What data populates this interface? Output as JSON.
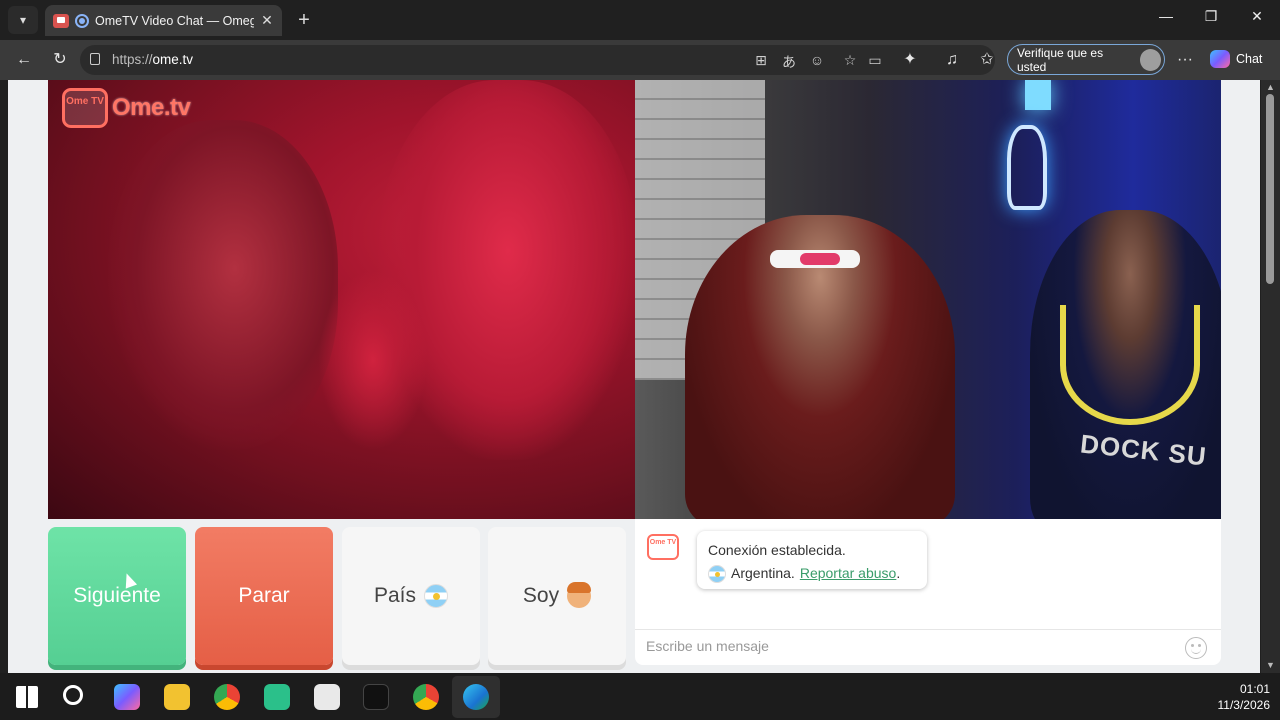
{
  "browser": {
    "tab_title": "OmeTV Video Chat — Omegle",
    "tab_close": "✕",
    "new_tab": "+",
    "url_prefix": "https://",
    "url_host": "ome.tv",
    "profile_label": "Verifique que es usted",
    "chat_label": "Chat",
    "more": "···"
  },
  "window_controls": {
    "minimize": "—",
    "restore": "❐",
    "close": "✕"
  },
  "logo": {
    "tv_text": "Ome TV",
    "brand": "Ome.tv"
  },
  "right_video": {
    "shirt_text": "DOCK SU"
  },
  "controls": {
    "next_label": "Siguiente",
    "stop_label": "Parar",
    "country_label": "País",
    "me_label": "Soy"
  },
  "chat": {
    "logo_text": "Ome TV",
    "status": "Conexión establecida.",
    "country": "Argentina.",
    "report_link": "Reportar abuso",
    "period": ".",
    "placeholder": "Escribe un mensaje"
  },
  "taskbar": {
    "time": "01:01",
    "date": "11/3/2026"
  },
  "colors": {
    "next": "#55cf93",
    "stop": "#e55f46",
    "link": "#3a9c6a",
    "brand": "#ff6f61"
  }
}
